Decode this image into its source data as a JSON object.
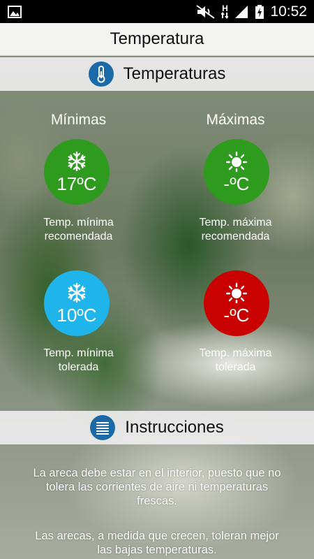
{
  "status_bar": {
    "time": "10:52",
    "network_label": "H",
    "icons": [
      "gallery-icon",
      "mute-icon",
      "hspa-icon",
      "signal-icon",
      "battery-charging-icon"
    ]
  },
  "title_bar": {
    "title": "Temperatura"
  },
  "temperatures_section": {
    "header": "Temperaturas",
    "icon": "thermometer-icon",
    "min_column_title": "Mínimas",
    "max_column_title": "Máximas",
    "cards": [
      {
        "value": "17ºC",
        "caption_line1": "Temp. mínima",
        "caption_line2": "recomendada",
        "icon": "snowflake-icon",
        "color": "#2e9a1e"
      },
      {
        "value": "-ºC",
        "caption_line1": "Temp. máxima",
        "caption_line2": "recomendada",
        "icon": "sun-icon",
        "color": "#2e9a1e"
      },
      {
        "value": "10ºC",
        "caption_line1": "Temp. mínima",
        "caption_line2": "tolerada",
        "icon": "snowflake-icon",
        "color": "#1fb4ea"
      },
      {
        "value": "-ºC",
        "caption_line1": "Temp. máxima",
        "caption_line2": "tolerada",
        "icon": "sun-icon",
        "color": "#c80000"
      }
    ]
  },
  "instructions_section": {
    "header": "Instrucciones",
    "icon": "document-lines-icon",
    "paragraph1_line1": "La areca debe estar en el interior, puesto que no",
    "paragraph1_line2": "tolera las corrientes de aire ni temperaturas",
    "paragraph1_line3": "frescas.",
    "paragraph2_line1": "Las arecas, a medida que crecen, toleran mejor",
    "paragraph2_line2": "las bajas temperaturas."
  },
  "colors": {
    "accent_blue": "#1a6aa8",
    "green": "#2e9a1e",
    "light_blue": "#1fb4ea",
    "red": "#c80000"
  }
}
